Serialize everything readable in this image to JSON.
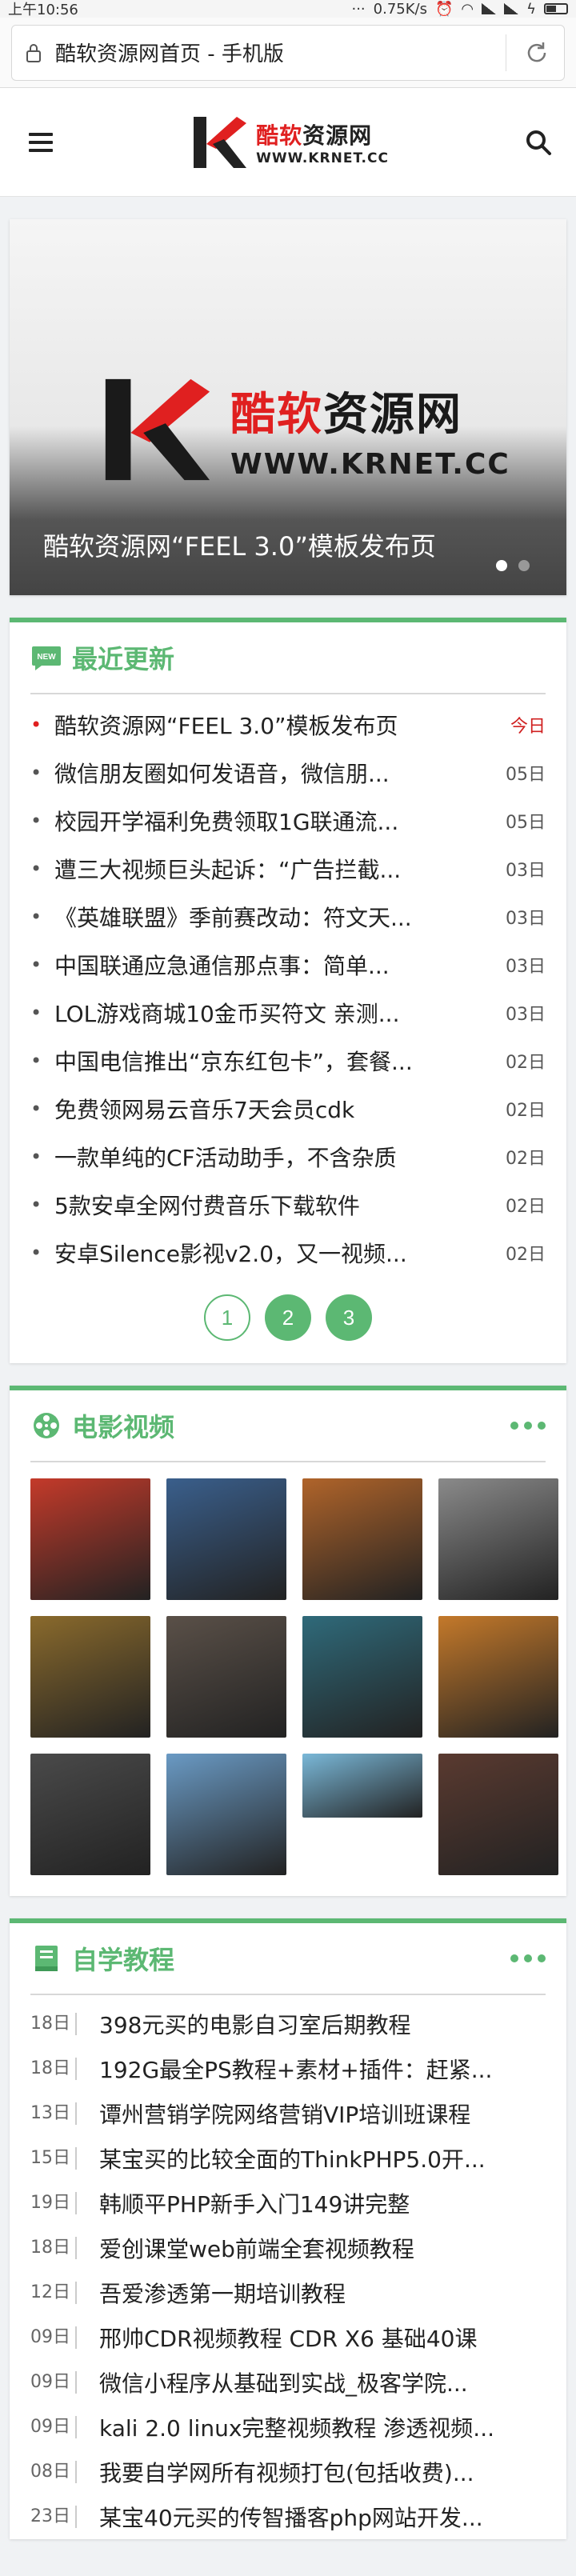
{
  "status_bar": {
    "time": "上午10:56",
    "net_speed": "0.75K/s"
  },
  "browser": {
    "url_title": "酷软资源网首页 - 手机版"
  },
  "header": {
    "logo_cn_red": "酷软",
    "logo_cn_rest": "资源网",
    "logo_en": "WWW.KRNET.CC"
  },
  "banner": {
    "logo_cn_red": "酷软",
    "logo_cn_rest": "资源网",
    "logo_en": "WWW.KRNET.CC",
    "caption": "酷软资源网“FEEL 3.0”模板发布页",
    "slide_count": 2,
    "active_slide": 1
  },
  "recent": {
    "title": "最近更新",
    "items": [
      {
        "title": "酷软资源网“FEEL 3.0”模板发布页",
        "date": "今日"
      },
      {
        "title": "微信朋友圈如何发语音，微信朋...",
        "date": "05日"
      },
      {
        "title": "校园开学福利免费领取1G联通流...",
        "date": "05日"
      },
      {
        "title": "遭三大视频巨头起诉：“广告拦截...",
        "date": "03日"
      },
      {
        "title": "《英雄联盟》季前赛改动：符文天...",
        "date": "03日"
      },
      {
        "title": "中国联通应急通信那点事：简单...",
        "date": "03日"
      },
      {
        "title": "LOL游戏商城10金币买符文 亲测...",
        "date": "03日"
      },
      {
        "title": "中国电信推出“京东红包卡”，套餐...",
        "date": "02日"
      },
      {
        "title": "免费领网易云音乐7天会员cdk",
        "date": "02日"
      },
      {
        "title": "一款单纯的CF活动助手，不含杂质",
        "date": "02日"
      },
      {
        "title": "5款安卓全网付费音乐下载软件",
        "date": "02日"
      },
      {
        "title": "安卓Silence影视v2.0，又一视频...",
        "date": "02日"
      }
    ],
    "pages": [
      "1",
      "2",
      "3"
    ]
  },
  "movies": {
    "title": "电影视频",
    "posters": [
      {
        "name": "poster-1",
        "color": "#c43a2a"
      },
      {
        "name": "poster-2",
        "color": "#3a5f8c"
      },
      {
        "name": "poster-3",
        "color": "#b0642a"
      },
      {
        "name": "poster-4",
        "color": "#8a8a8a"
      },
      {
        "name": "poster-5",
        "color": "#8a6a2c"
      },
      {
        "name": "poster-6",
        "color": "#5a5048"
      },
      {
        "name": "poster-7",
        "color": "#2f6a7a"
      },
      {
        "name": "poster-8",
        "color": "#c4792a"
      },
      {
        "name": "poster-9",
        "color": "#4a4a4a"
      },
      {
        "name": "poster-10",
        "color": "#6a9ac4"
      },
      {
        "name": "poster-11",
        "color": "#7ab8d8"
      },
      {
        "name": "poster-12",
        "color": "#5a3a30"
      }
    ]
  },
  "self_study": {
    "title": "自学教程",
    "items": [
      {
        "date": "18日",
        "title": "398元买的电影自习室后期教程"
      },
      {
        "date": "18日",
        "title": "192G最全PS教程+素材+插件：赶紧..."
      },
      {
        "date": "13日",
        "title": "谭州营销学院网络营销VIP培训班课程"
      },
      {
        "date": "15日",
        "title": "某宝买的比较全面的ThinkPHP5.0开..."
      },
      {
        "date": "19日",
        "title": "韩顺平PHP新手入门149讲完整"
      },
      {
        "date": "18日",
        "title": "爱创课堂web前端全套视频教程"
      },
      {
        "date": "12日",
        "title": "吾爱渗透第一期培训教程"
      },
      {
        "date": "09日",
        "title": "邢帅CDR视频教程 CDR X6 基础40课"
      },
      {
        "date": "09日",
        "title": "微信小程序从基础到实战_极客学院..."
      },
      {
        "date": "09日",
        "title": "kali 2.0 linux完整视频教程 渗透视频..."
      },
      {
        "date": "08日",
        "title": "我要自学网所有视频打包(包括收费)..."
      },
      {
        "date": "23日",
        "title": "某宝40元买的传智播客php网站开发..."
      }
    ]
  },
  "colors": {
    "accent": "#5cb873",
    "brand_red": "#e02020"
  }
}
